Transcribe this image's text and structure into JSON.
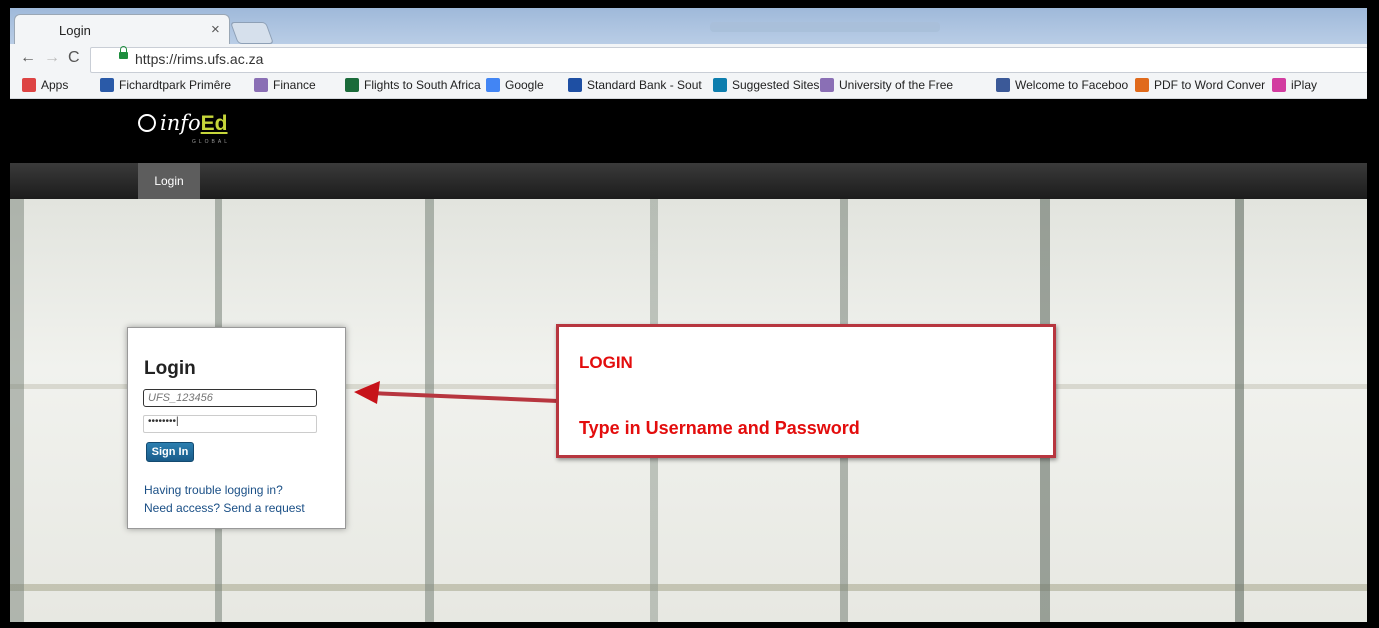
{
  "browser": {
    "tab_title": "Login",
    "tab_close": "×",
    "url": "https://rims.ufs.ac.za",
    "back_icon": "←",
    "forward_icon": "→",
    "reload_icon": "C"
  },
  "bookmarks": [
    {
      "label": "Apps",
      "icon": "apps-icon",
      "color": "#d44"
    },
    {
      "label": "Fichardtpark Primêre",
      "icon": "school-icon",
      "color": "#2a5aa8"
    },
    {
      "label": "Finance",
      "icon": "university-icon",
      "color": "#8a6fb5"
    },
    {
      "label": "Flights to South Africa",
      "icon": "plane-icon",
      "color": "#1a6b3a"
    },
    {
      "label": "Google",
      "icon": "google-icon",
      "color": "#4285f4"
    },
    {
      "label": "Standard Bank - Sout",
      "icon": "bank-icon",
      "color": "#1e4fa3"
    },
    {
      "label": "Suggested Sites",
      "icon": "bing-icon",
      "color": "#0d7eae"
    },
    {
      "label": "University of the Free",
      "icon": "university-icon",
      "color": "#8a6fb5"
    },
    {
      "label": "Welcome to Faceboo",
      "icon": "facebook-icon",
      "color": "#3b5998"
    },
    {
      "label": "PDF to Word Conver",
      "icon": "pdf-icon",
      "color": "#e06a1c"
    },
    {
      "label": "iPlay",
      "icon": "iplay-icon",
      "color": "#d23ca0"
    }
  ],
  "site": {
    "logo_text": "info",
    "logo_ed": "Ed",
    "logo_sub": "GLOBAL",
    "nav_login": "Login"
  },
  "login": {
    "title": "Login",
    "username_placeholder": "UFS_123456",
    "password_mask": "••••••••|",
    "signin_label": "Sign In",
    "help_trouble": "Having trouble logging in?",
    "help_access": "Need access? Send a request"
  },
  "annotation": {
    "title": "LOGIN",
    "text": "Type in Username and Password",
    "color": "#e30d0d"
  }
}
